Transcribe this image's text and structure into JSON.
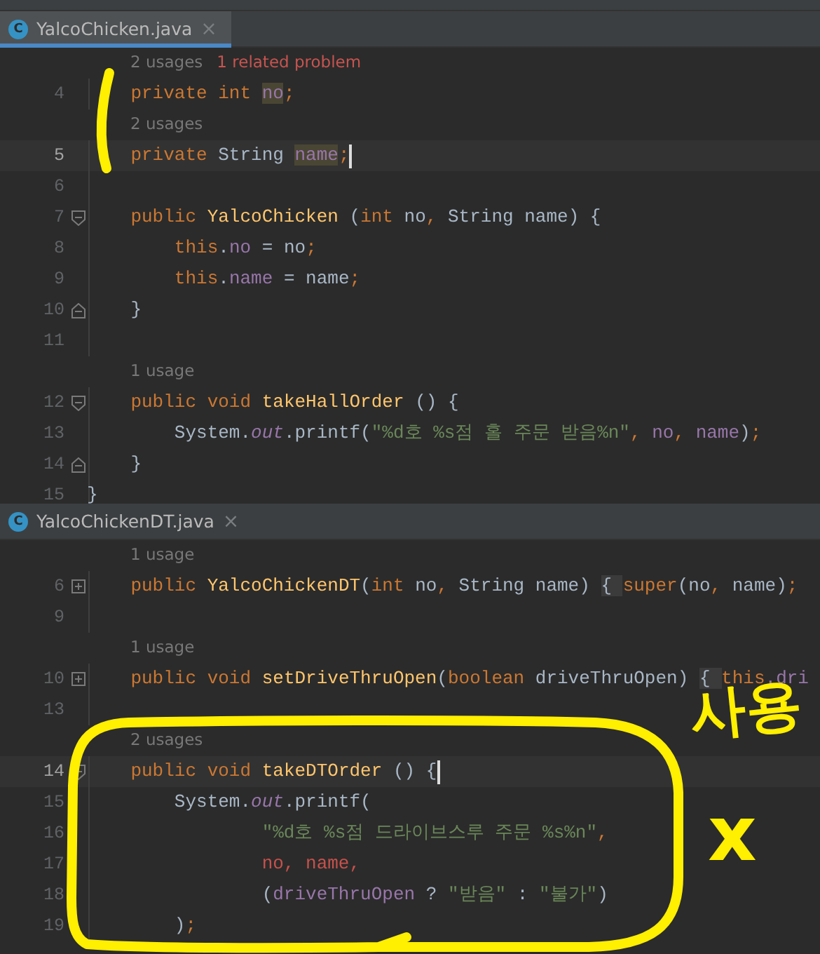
{
  "panes": [
    {
      "tab": {
        "icon_letter": "C",
        "title": "YalcoChicken.java",
        "close": "×",
        "selected": true
      },
      "lines": [
        {
          "kind": "hint",
          "parts": [
            {
              "text": "2 usages",
              "kind": "usage"
            },
            {
              "text": "1 related problem",
              "kind": "problem"
            }
          ]
        },
        {
          "kind": "code",
          "number": "4",
          "current": false,
          "tokens": [
            {
              "t": "    private ",
              "kind": "kw"
            },
            {
              "t": "int ",
              "kind": "kw"
            },
            {
              "t": "no",
              "kind": "fieldhl"
            },
            {
              "t": ";",
              "kind": "kw"
            }
          ]
        },
        {
          "kind": "hint",
          "parts": [
            {
              "text": "2 usages",
              "kind": "usage"
            }
          ]
        },
        {
          "kind": "code",
          "number": "5",
          "current": true,
          "tokens": [
            {
              "t": "    private ",
              "kind": "kw"
            },
            {
              "t": "String "
            },
            {
              "t": "name",
              "kind": "fieldhl"
            },
            {
              "t": ";",
              "kind": "kw"
            }
          ]
        },
        {
          "kind": "code",
          "number": "6",
          "current": false
        },
        {
          "kind": "code",
          "number": "7",
          "current": false,
          "gutter": {
            "kind": "fold-start"
          },
          "tokens": [
            {
              "t": "    public ",
              "kind": "kw"
            },
            {
              "t": "YalcoChicken",
              "kind": "decl"
            },
            {
              "t": " ("
            },
            {
              "t": "int ",
              "kind": "kw"
            },
            {
              "t": "no"
            },
            {
              "t": ", ",
              "kind": "kw"
            },
            {
              "t": "String name) {"
            }
          ]
        },
        {
          "kind": "code",
          "number": "8",
          "current": false,
          "tokens": [
            {
              "t": "        this",
              "kind": "kw"
            },
            {
              "t": "."
            },
            {
              "t": "no",
              "kind": "field"
            },
            {
              "t": " = no"
            },
            {
              "t": ";",
              "kind": "kw"
            }
          ]
        },
        {
          "kind": "code",
          "number": "9",
          "current": false,
          "tokens": [
            {
              "t": "        this",
              "kind": "kw"
            },
            {
              "t": "."
            },
            {
              "t": "name",
              "kind": "field"
            },
            {
              "t": " = name"
            },
            {
              "t": ";",
              "kind": "kw"
            }
          ]
        },
        {
          "kind": "code",
          "number": "10",
          "current": false,
          "gutter": {
            "kind": "fold-end"
          },
          "tokens": [
            {
              "t": "    }"
            }
          ]
        },
        {
          "kind": "code",
          "number": "11",
          "current": false
        },
        {
          "kind": "hint",
          "parts": [
            {
              "text": "1 usage",
              "kind": "usage"
            }
          ]
        },
        {
          "kind": "code",
          "number": "12",
          "current": false,
          "gutter": {
            "kind": "fold-start"
          },
          "tokens": [
            {
              "t": "    public ",
              "kind": "kw"
            },
            {
              "t": "void ",
              "kind": "kw"
            },
            {
              "t": "takeHallOrder",
              "kind": "decl"
            },
            {
              "t": " () {"
            }
          ]
        },
        {
          "kind": "code",
          "number": "13",
          "current": false,
          "tokens": [
            {
              "t": "        System."
            },
            {
              "t": "out",
              "kind": "static"
            },
            {
              "t": ".printf("
            },
            {
              "t": "\"%d호 %s점 홀 주문 받음%n\"",
              "kind": "str"
            },
            {
              "t": ", ",
              "kind": "kw"
            },
            {
              "t": "no",
              "kind": "field"
            },
            {
              "t": ", ",
              "kind": "kw"
            },
            {
              "t": "name",
              "kind": "field"
            },
            {
              "t": ")"
            },
            {
              "t": ";",
              "kind": "kw"
            }
          ]
        },
        {
          "kind": "code",
          "number": "14",
          "current": false,
          "gutter": {
            "kind": "fold-end"
          },
          "tokens": [
            {
              "t": "    }"
            }
          ]
        },
        {
          "kind": "code",
          "number": "15",
          "current": false,
          "tokens": [
            {
              "t": "}"
            }
          ]
        }
      ]
    },
    {
      "tab": {
        "icon_letter": "C",
        "title": "YalcoChickenDT.java",
        "close": "×",
        "selected": false
      },
      "lines": [
        {
          "kind": "hint",
          "parts": [
            {
              "text": "1 usage",
              "kind": "usage"
            }
          ]
        },
        {
          "kind": "code",
          "number": "6",
          "current": false,
          "gutter": {
            "kind": "collapsed"
          },
          "tokens": [
            {
              "t": "    public ",
              "kind": "kw"
            },
            {
              "t": "YalcoChickenDT",
              "kind": "decl"
            },
            {
              "t": "("
            },
            {
              "t": "int ",
              "kind": "kw"
            },
            {
              "t": "no"
            },
            {
              "t": ", ",
              "kind": "kw"
            },
            {
              "t": "String name) "
            },
            {
              "t": "{ ",
              "kind": "folded"
            },
            {
              "t": "super",
              "kind": "kw"
            },
            {
              "t": "(no"
            },
            {
              "t": ", ",
              "kind": "kw"
            },
            {
              "t": "name)"
            },
            {
              "t": ";",
              "kind": "kw"
            }
          ]
        },
        {
          "kind": "code",
          "number": "9",
          "current": false
        },
        {
          "kind": "hint",
          "parts": [
            {
              "text": "1 usage",
              "kind": "usage"
            }
          ]
        },
        {
          "kind": "code",
          "number": "10",
          "current": false,
          "gutter": {
            "kind": "collapsed"
          },
          "tokens": [
            {
              "t": "    public ",
              "kind": "kw"
            },
            {
              "t": "void ",
              "kind": "kw"
            },
            {
              "t": "setDriveThruOpen",
              "kind": "decl"
            },
            {
              "t": "("
            },
            {
              "t": "boolean ",
              "kind": "kw"
            },
            {
              "t": "driveThruOpen) "
            },
            {
              "t": "{ ",
              "kind": "folded"
            },
            {
              "t": "this",
              "kind": "kw"
            },
            {
              "t": ".dri",
              "kind": "field"
            }
          ]
        },
        {
          "kind": "code",
          "number": "13",
          "current": false
        },
        {
          "kind": "hint",
          "parts": [
            {
              "text": "2 usages",
              "kind": "usage"
            }
          ]
        },
        {
          "kind": "code",
          "number": "14",
          "current": true,
          "gutter": {
            "kind": "fold-start"
          },
          "tokens": [
            {
              "t": "    public ",
              "kind": "kw"
            },
            {
              "t": "void ",
              "kind": "kw"
            },
            {
              "t": "takeDTOrder",
              "kind": "decl"
            },
            {
              "t": " () {"
            }
          ]
        },
        {
          "kind": "code",
          "number": "15",
          "current": false,
          "tokens": [
            {
              "t": "        System."
            },
            {
              "t": "out",
              "kind": "static"
            },
            {
              "t": ".printf("
            }
          ]
        },
        {
          "kind": "code",
          "number": "16",
          "current": false,
          "tokens": [
            {
              "t": "                \"%d호 %s점 드라이브스루 주문 %s%n\"",
              "kind": "str"
            },
            {
              "t": ",",
              "kind": "kw"
            }
          ]
        },
        {
          "kind": "code",
          "number": "17",
          "current": false,
          "tokens": [
            {
              "t": "                no, name,",
              "kind": "err"
            }
          ]
        },
        {
          "kind": "code",
          "number": "18",
          "current": false,
          "tokens": [
            {
              "t": "                ("
            },
            {
              "t": "driveThruOpen",
              "kind": "field"
            },
            {
              "t": " ? "
            },
            {
              "t": "\"받음\"",
              "kind": "str"
            },
            {
              "t": " : "
            },
            {
              "t": "\"불가\"",
              "kind": "str"
            },
            {
              "t": ")"
            }
          ]
        },
        {
          "kind": "code",
          "number": "19",
          "current": false,
          "tokens": [
            {
              "t": "        )"
            },
            {
              "t": ";",
              "kind": "kw"
            }
          ]
        }
      ]
    }
  ],
  "annotation": {
    "note": "사용",
    "mark": "x"
  }
}
